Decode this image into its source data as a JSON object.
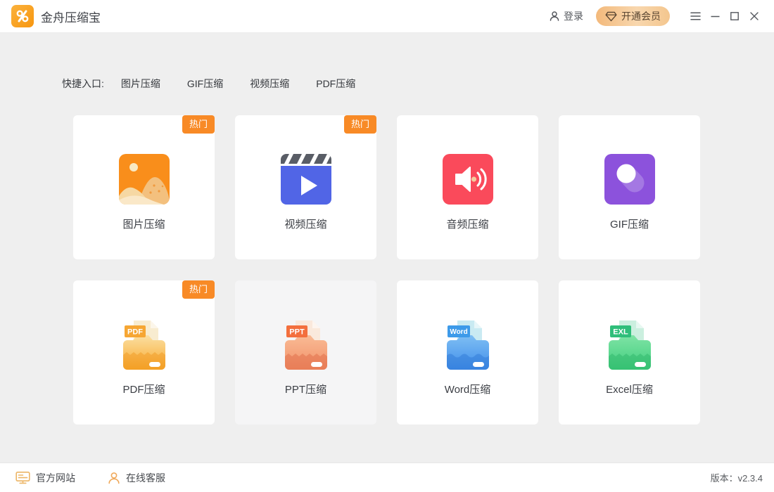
{
  "titlebar": {
    "app_title": "金舟压缩宝",
    "login_label": "登录",
    "vip_label": "开通会员"
  },
  "quick_entry": {
    "label": "快捷入口:",
    "links": [
      "图片压缩",
      "GIF压缩",
      "视频压缩",
      "PDF压缩"
    ]
  },
  "cards": [
    {
      "label": "图片压缩",
      "badge": "热门",
      "icon": "image-icon"
    },
    {
      "label": "视频压缩",
      "badge": "热门",
      "icon": "video-icon"
    },
    {
      "label": "音频压缩",
      "icon": "audio-icon"
    },
    {
      "label": "GIF压缩",
      "icon": "gif-icon"
    },
    {
      "label": "PDF压缩",
      "badge": "热门",
      "tag": "PDF",
      "icon": "pdf-folder-icon"
    },
    {
      "label": "PPT压缩",
      "tag": "PPT",
      "icon": "ppt-folder-icon"
    },
    {
      "label": "Word压缩",
      "tag": "Word",
      "icon": "word-folder-icon"
    },
    {
      "label": "Excel压缩",
      "tag": "EXL",
      "icon": "excel-folder-icon"
    }
  ],
  "footer": {
    "website_label": "官方网站",
    "service_label": "在线客服",
    "version_label": "版本：v2.3.4"
  },
  "colors": {
    "accent_orange": "#f88a26",
    "vip_pill_start": "#f3b97b",
    "vip_pill_end": "#f4c68e",
    "content_bg": "#efefef"
  }
}
